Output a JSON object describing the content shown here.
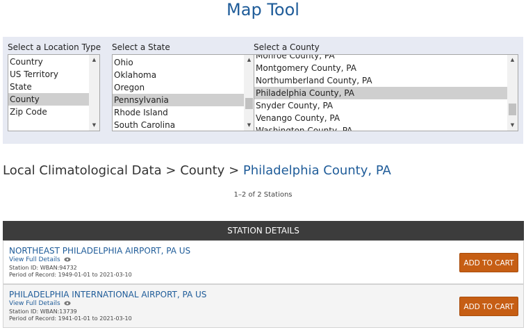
{
  "page": {
    "title": "Map Tool"
  },
  "selectors": {
    "location_type": {
      "label": "Select a Location Type",
      "options": [
        "Country",
        "US Territory",
        "State",
        "County",
        "Zip Code"
      ],
      "selected": "County"
    },
    "state": {
      "label": "Select a State",
      "options": [
        "Ohio",
        "Oklahoma",
        "Oregon",
        "Pennsylvania",
        "Rhode Island",
        "South Carolina"
      ],
      "selected": "Pennsylvania"
    },
    "county": {
      "label": "Select a County",
      "options": [
        "Monroe County, PA",
        "Montgomery County, PA",
        "Northumberland County, PA",
        "Philadelphia County, PA",
        "Snyder County, PA",
        "Venango County, PA",
        "Washington County, PA"
      ],
      "selected": "Philadelphia County, PA"
    }
  },
  "breadcrumb": {
    "root": "Local Climatological Data",
    "separator": ">",
    "level": "County",
    "current": "Philadelphia County, PA"
  },
  "results": {
    "count_text": "1–2 of 2 Stations"
  },
  "table": {
    "header": "STATION DETAILS",
    "stations": [
      {
        "name": "NORTHEAST PHILADELPHIA AIRPORT, PA US",
        "details_link": "View Full Details",
        "station_id": "Station ID: WBAN:94732",
        "period": "Period of Record: 1949-01-01 to 2021-03-10",
        "button": "ADD TO CART"
      },
      {
        "name": "PHILADELPHIA INTERNATIONAL AIRPORT, PA US",
        "details_link": "View Full Details",
        "station_id": "Station ID: WBAN:13739",
        "period": "Period of Record: 1941-01-01 to 2021-03-10",
        "button": "ADD TO CART"
      }
    ]
  },
  "icons": {
    "details": "eye-icon",
    "scroll_up": "scroll-up-arrow-icon",
    "scroll_down": "scroll-down-arrow-icon"
  },
  "colors": {
    "link": "#1f5c99",
    "cart_button": "#c65e14",
    "table_header": "#3c3c3c",
    "panel": "#e7eaf3",
    "selected_option": "#cfcfcf"
  }
}
